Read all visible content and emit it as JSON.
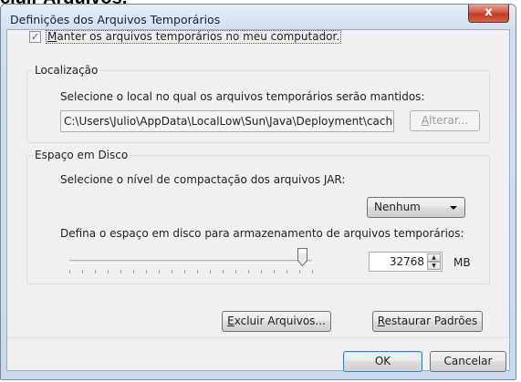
{
  "page_heading": "cluir Arquivos,",
  "dialog": {
    "title": "Definições dos Arquivos Temporários",
    "close_glyph": "x"
  },
  "keep_files": {
    "checked": true,
    "check_glyph": "✓",
    "label": "Manter os arquivos temporários no meu computador."
  },
  "location": {
    "group_title": "Localização",
    "description": "Selecione o local no qual os arquivos temporários serão mantidos:",
    "path": "C:\\Users\\Julio\\AppData\\LocalLow\\Sun\\Java\\Deployment\\cache",
    "change_button": "Alterar..."
  },
  "disk": {
    "group_title": "Espaço em Disco",
    "compression_label": "Selecione o nível de compactação dos arquivos JAR:",
    "compression_value": "Nenhum",
    "space_label": "Defina o espaço em disco para armazenamento de arquivos temporários:",
    "slider_fraction": 0.96,
    "space_value": "32768",
    "unit": "MB",
    "spin_up_glyph": "▲",
    "spin_down_glyph": "▼"
  },
  "actions": {
    "delete_files": "Excluir Arquivos...",
    "restore_defaults": "Restaurar Padrões"
  },
  "footer": {
    "ok": "OK",
    "cancel": "Cancelar"
  }
}
